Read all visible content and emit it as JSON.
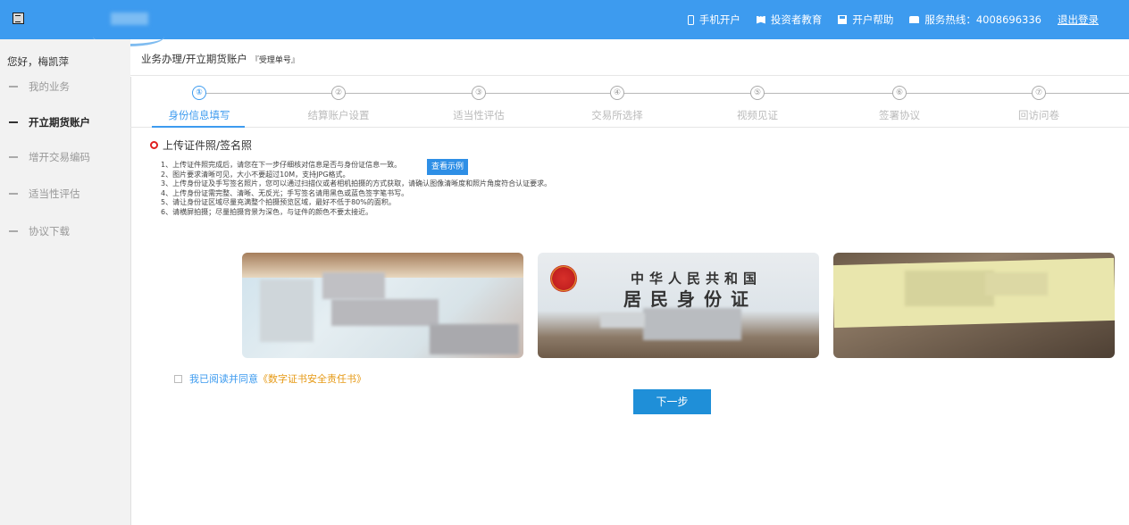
{
  "topbar": {
    "nav": [
      {
        "label": "手机开户",
        "icon": "phone-icon"
      },
      {
        "label": "投资者教育",
        "icon": "book-icon"
      },
      {
        "label": "开户帮助",
        "icon": "save-icon"
      },
      {
        "label": "服务热线：4008696336",
        "icon": "telephone-icon"
      }
    ],
    "logout": "退出登录"
  },
  "sidebar": {
    "greeting": "您好，梅凯萍",
    "items": [
      {
        "label": "我的业务"
      },
      {
        "label": "开立期货账户"
      },
      {
        "label": "增开交易编码"
      },
      {
        "label": "适当性评估"
      },
      {
        "label": "协议下载"
      }
    ]
  },
  "breadcrumb": {
    "path": "业务办理/开立期货账户",
    "sub": "『受理单号』"
  },
  "steps": [
    {
      "num": "①",
      "label": "身份信息填写"
    },
    {
      "num": "②",
      "label": "结算账户设置"
    },
    {
      "num": "③",
      "label": "适当性评估"
    },
    {
      "num": "④",
      "label": "交易所选择"
    },
    {
      "num": "⑤",
      "label": "视频见证"
    },
    {
      "num": "⑥",
      "label": "签署协议"
    },
    {
      "num": "⑦",
      "label": "回访问卷"
    }
  ],
  "upload": {
    "title": "上传证件照/签名照",
    "notes": [
      "1、上传证件照完成后，请您在下一步仔细核对信息是否与身份证信息一致。",
      "2、图片要求清晰可见，大小不要超过10M，支持JPG格式。",
      "3、上传身份证及手写签名照片，您可以通过扫描仪或者相机拍摄的方式获取，请确认图像清晰度和照片角度符合认证要求。",
      "4、上传身份证需完整、清晰、无反光；手写签名请用黑色或蓝色签字笔书写。",
      "5、请让身份证区域尽量充满整个拍摄预览区域，最好不低于80%的面积。",
      "6、请横屏拍摄；尽量拍摄背景为深色，与证件的颜色不要太接近。"
    ],
    "example_button": "查看示例",
    "id_back_title_1": "中华人民共和国",
    "id_back_title_2": "居民身份证"
  },
  "agreement": {
    "prefix": "我已阅读并同意",
    "link": "《数字证书安全责任书》"
  },
  "next_button": "下一步",
  "colors": {
    "primary": "#3d9bef",
    "link_orange": "#e69a16",
    "required_red": "#e02020"
  }
}
